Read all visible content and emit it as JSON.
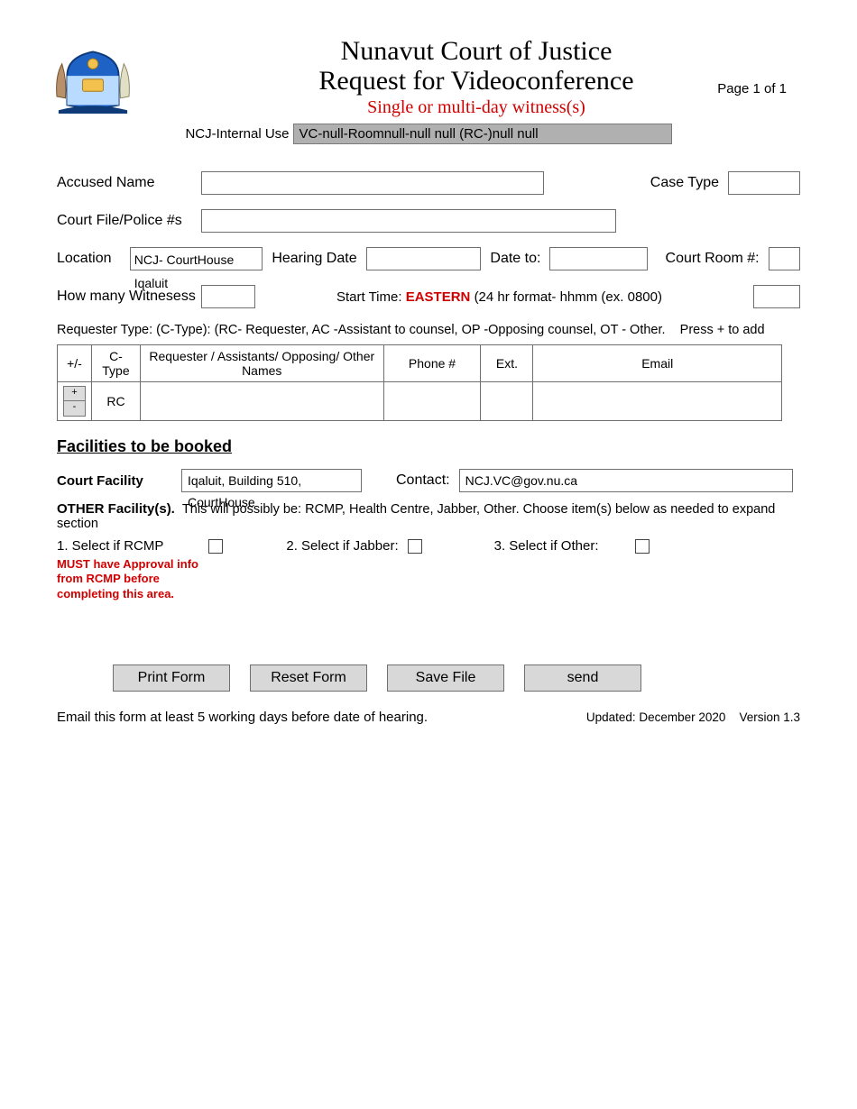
{
  "header": {
    "title": "Nunavut Court of Justice",
    "subtitle": "Request for Videoconference",
    "note": "Single or multi-day witness(s)",
    "page_label": "Page 1 of 1",
    "internal_label": "NCJ-Internal Use",
    "internal_value": "VC-null-Roomnull-null null (RC-)null null"
  },
  "labels": {
    "accused": "Accused  Name",
    "case_type": "Case Type",
    "court_file": "Court File/Police #s",
    "location": "Location",
    "hearing_date": "Hearing Date",
    "date_to": "Date to:",
    "court_room": "Court Room #:",
    "witnesses": "How many Witnesess",
    "start_time_prefix": "Start Time:",
    "start_time_bold": "EASTERN",
    "start_time_suffix": "(24 hr format- hhmm (ex. 0800)",
    "req_type_hint": "Requester Type: (C-Type): (RC- Requester, AC -Assistant to counsel, OP -Opposing counsel, OT - Other.    Press + to add"
  },
  "fields": {
    "accused": "",
    "case_type": "",
    "court_file": "",
    "location": "NCJ- CourtHouse Iqaluit",
    "hearing_date": "",
    "date_to": "",
    "court_room": "",
    "witnesses": "",
    "start_time": ""
  },
  "req_table": {
    "headers": {
      "pm": "+/-",
      "ctype": "C-Type",
      "name": "Requester / Assistants/ Opposing/ Other Names",
      "phone": "Phone #",
      "ext": "Ext.",
      "email": "Email"
    },
    "rows": [
      {
        "ctype": "RC",
        "name": "",
        "phone": "",
        "ext": "",
        "email": ""
      }
    ],
    "plus": "+",
    "minus": "-"
  },
  "facilities": {
    "heading": "Facilities to be booked",
    "court_label": "Court Facility",
    "court_value": "Iqaluit, Building 510, CourtHouse",
    "contact_label": "Contact:",
    "contact_value": "NCJ.VC@gov.nu.ca",
    "other_label": "OTHER Facility(s).",
    "other_text": "This will possibly be: RCMP, Health Centre, Jabber, Other. Choose item(s) below as needed to expand  section",
    "select_rcmp": "1. Select if RCMP",
    "select_jabber": "2. Select if Jabber:",
    "select_other": "3. Select if Other:",
    "rcmp_warn": "MUST have Approval info from RCMP before completing this area."
  },
  "buttons": {
    "print": "Print Form",
    "reset": "Reset Form",
    "save": "Save File",
    "send": "send"
  },
  "footer": {
    "instruction": "Email this form at least 5 working days before date of hearing.",
    "updated": "Updated: December  2020",
    "version": "Version 1.3"
  }
}
